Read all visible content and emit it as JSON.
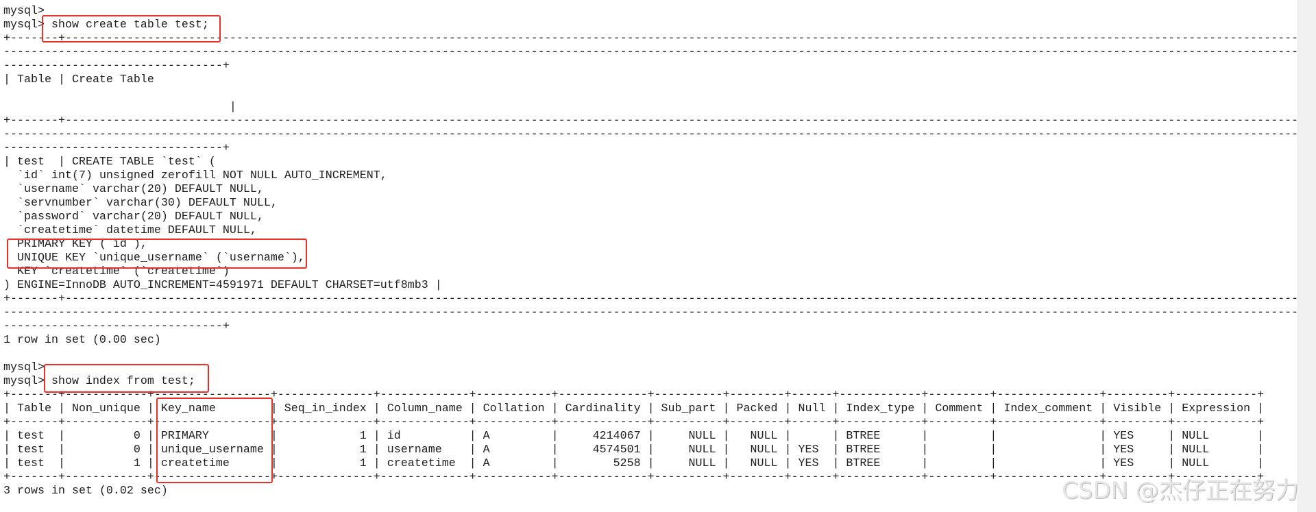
{
  "prompt": "mysql> ",
  "session": {
    "blank_prompt_1": "mysql> ",
    "command_1": "show create table test;",
    "create_table": {
      "headers": [
        "Table",
        "Create Table"
      ],
      "table_name": "test",
      "statement_lines": [
        "CREATE TABLE `test` (",
        "  `id` int(7) unsigned zerofill NOT NULL AUTO_INCREMENT,",
        "  `username` varchar(20) DEFAULT NULL,",
        "  `servnumber` varchar(30) DEFAULT NULL,",
        "  `password` varchar(20) DEFAULT NULL,",
        "  `createtime` datetime DEFAULT NULL,",
        "  PRIMARY KEY (`id`),",
        "  UNIQUE KEY `unique_username` (`username`),",
        "  KEY `createtime` (`createtime`)",
        ") ENGINE=InnoDB AUTO_INCREMENT=4591971 DEFAULT CHARSET=utf8mb3"
      ]
    },
    "result_1": "1 row in set (0.00 sec)",
    "blank_prompt_2": "mysql> ",
    "command_2": "show index from test;",
    "index_table": {
      "headers": [
        "Table",
        "Non_unique",
        "Key_name",
        "Seq_in_index",
        "Column_name",
        "Collation",
        "Cardinality",
        "Sub_part",
        "Packed",
        "Null",
        "Index_type",
        "Comment",
        "Index_comment",
        "Visible",
        "Expression"
      ],
      "rows": [
        [
          "test",
          "0",
          "PRIMARY",
          "1",
          "id",
          "A",
          "4214067",
          "NULL",
          "NULL",
          "",
          "BTREE",
          "",
          "",
          "YES",
          "NULL"
        ],
        [
          "test",
          "0",
          "unique_username",
          "1",
          "username",
          "A",
          "4574501",
          "NULL",
          "NULL",
          "YES",
          "BTREE",
          "",
          "",
          "YES",
          "NULL"
        ],
        [
          "test",
          "1",
          "createtime",
          "1",
          "createtime",
          "A",
          "5258",
          "NULL",
          "NULL",
          "YES",
          "BTREE",
          "",
          "",
          "YES",
          "NULL"
        ]
      ]
    },
    "result_2": "3 rows in set (0.02 sec)"
  },
  "watermark": "CSDN @杰仔正在努力",
  "colors": {
    "highlight": "#e8302a",
    "text": "#1e1e1e",
    "background": "#ffffff"
  }
}
